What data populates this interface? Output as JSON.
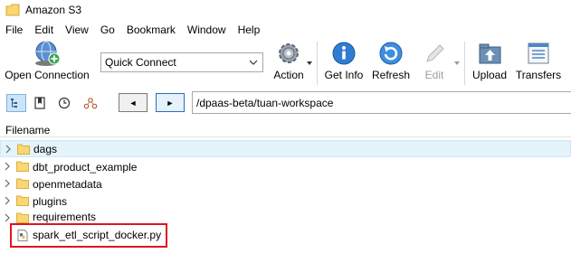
{
  "window": {
    "title": "Amazon S3"
  },
  "menu": [
    "File",
    "Edit",
    "View",
    "Go",
    "Bookmark",
    "Window",
    "Help"
  ],
  "toolbar": {
    "open_connection": "Open Connection",
    "quick_connect": "Quick Connect",
    "action": "Action",
    "get_info": "Get Info",
    "refresh": "Refresh",
    "edit": "Edit",
    "upload": "Upload",
    "transfers": "Transfers"
  },
  "nav": {
    "path": "/dpaas-beta/tuan-workspace",
    "back": "◄",
    "forward": "►"
  },
  "list": {
    "header": "Filename",
    "folders": [
      "dags",
      "dbt_product_example",
      "openmetadata",
      "plugins",
      "requirements"
    ],
    "file": "spark_etl_script_docker.py"
  },
  "colors": {
    "selection": "#e5f3fb",
    "highlight_border": "#e0141e",
    "folder": "#f8d775"
  },
  "icons": [
    "app-icon",
    "globe-icon",
    "gear-icon",
    "info-icon",
    "refresh-icon",
    "pencil-icon",
    "upload-icon",
    "transfers-icon",
    "tree-view-icon",
    "bookmark-icon",
    "clock-icon",
    "bonjour-icon",
    "folder-icon",
    "python-file-icon"
  ]
}
